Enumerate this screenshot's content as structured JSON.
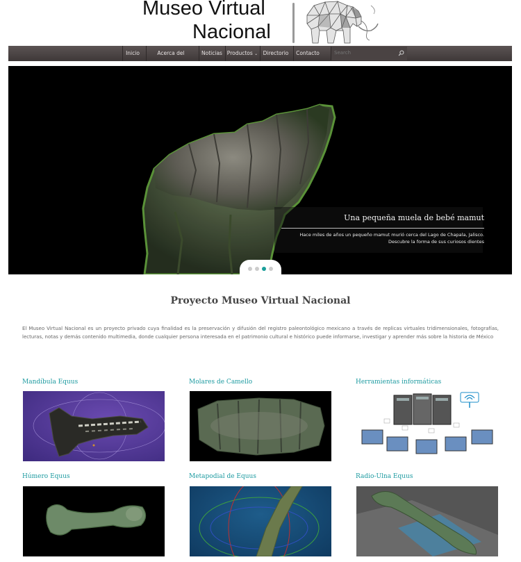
{
  "site": {
    "logo_line1": "Museo Virtual",
    "logo_line2": "Nacional"
  },
  "nav": {
    "items": [
      {
        "label": "Inicio"
      },
      {
        "label": "Acerca del proyecto"
      },
      {
        "label": "Noticias"
      },
      {
        "label": "Productos"
      },
      {
        "label": "Directorio"
      },
      {
        "label": "Contacto"
      }
    ],
    "search_placeholder": "Search",
    "dropdown_icon": "chevron-down-icon",
    "search_icon": "search-icon"
  },
  "slider": {
    "caption_title": "Una pequeña muela de bebé mamut",
    "caption_desc_line1": "Hace miles de años un pequeño mamut murió cerca del Lago de Chapala, Jalisco.",
    "caption_desc_line2": "Descubre la forma de sus curiosos dientes",
    "slide_count": 4,
    "active_slide": 3
  },
  "main": {
    "title": "Proyecto Museo Virtual Nacional",
    "intro": "El Museo Virtual Nacional es un proyecto privado cuya finalidad es la preservación y difusión del registro paleontológico mexicano a través de replicas virtuales tridimensionales, fotografías, lecturas, notas y demás contenido multimedia, donde cualquier persona interesada en el patrimonio cultural e histórico puede informarse, investigar y aprender más sobre la historia de México"
  },
  "cards": [
    {
      "title": "Mandíbula Equus"
    },
    {
      "title": "Molares de Camello"
    },
    {
      "title": "Herramientas informáticas"
    },
    {
      "title": "Húmero Equus"
    },
    {
      "title": "Metapodial de Equus"
    },
    {
      "title": "Radio-Ulna Equus"
    }
  ],
  "colors": {
    "accent": "#1c9aa0",
    "nav_bg": "#4a4343",
    "active_dot": "#1a9e9a"
  }
}
